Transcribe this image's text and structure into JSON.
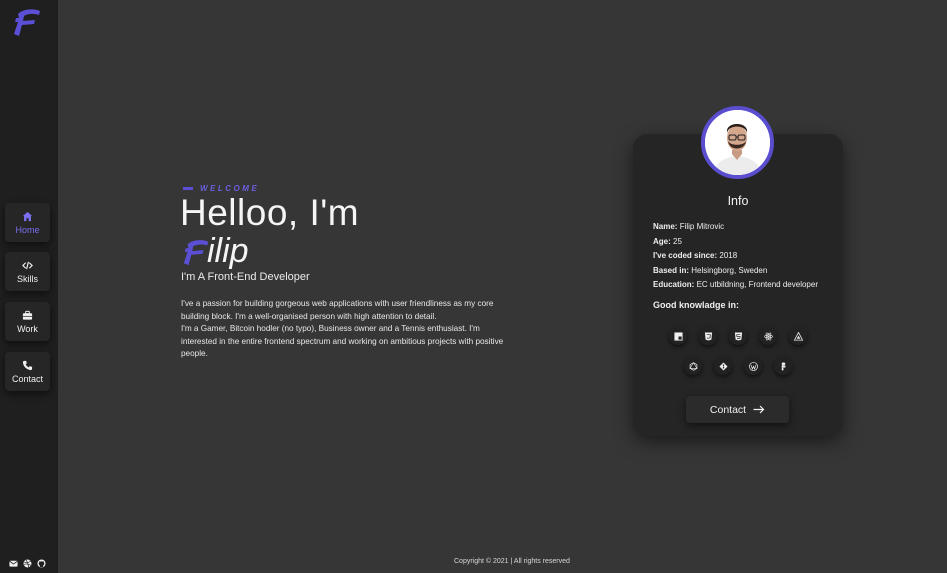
{
  "nav": {
    "items": [
      {
        "label": "Home",
        "icon": "home-icon",
        "active": true
      },
      {
        "label": "Skills",
        "icon": "code-icon",
        "active": false
      },
      {
        "label": "Work",
        "icon": "briefcase-icon",
        "active": false
      },
      {
        "label": "Contact",
        "icon": "phone-icon",
        "active": false
      }
    ],
    "social_icons": [
      "mail-icon",
      "dribbble-icon",
      "github-icon"
    ]
  },
  "hero": {
    "welcome": "WELCOME",
    "greeting": "Helloo, I'm",
    "name_rest": "ilip",
    "role": "I'm A Front-End Developer",
    "bio_lines": [
      "I've a passion for building gorgeous web applications with user friendliness as my core building block. I'm a well-organised person with high attention to detail.",
      "I'm a Gamer, Bitcoin hodler (no typo), Business owner and a Tennis enthusiast. I'm interested in the entire frontend spectrum and working on ambitious projects with positive people."
    ]
  },
  "card": {
    "title": "Info",
    "fields": [
      {
        "label": "Name:",
        "value": "Filip Mitrovic"
      },
      {
        "label": "Age:",
        "value": "25"
      },
      {
        "label": "I've coded since:",
        "value": "2018"
      },
      {
        "label": "Based in:",
        "value": "Helsingborg, Sweden"
      },
      {
        "label": "Education:",
        "value": "EC utbildning, Frontend developer"
      }
    ],
    "skills_heading": "Good knowladge in:",
    "skill_icons_row1": [
      "javascript-icon",
      "css3-icon",
      "html5-icon",
      "react-icon",
      "webpack-icon"
    ],
    "skill_icons_row2": [
      "graphql-icon",
      "git-icon",
      "wordpress-icon",
      "figma-icon"
    ],
    "contact_label": "Contact"
  },
  "footer": {
    "copyright": "Copyright © 2021 | All rights reserved"
  },
  "colors": {
    "accent": "#5b4fd6",
    "background": "#353635",
    "sidebar": "#1f1f1f",
    "card": "#252525"
  }
}
